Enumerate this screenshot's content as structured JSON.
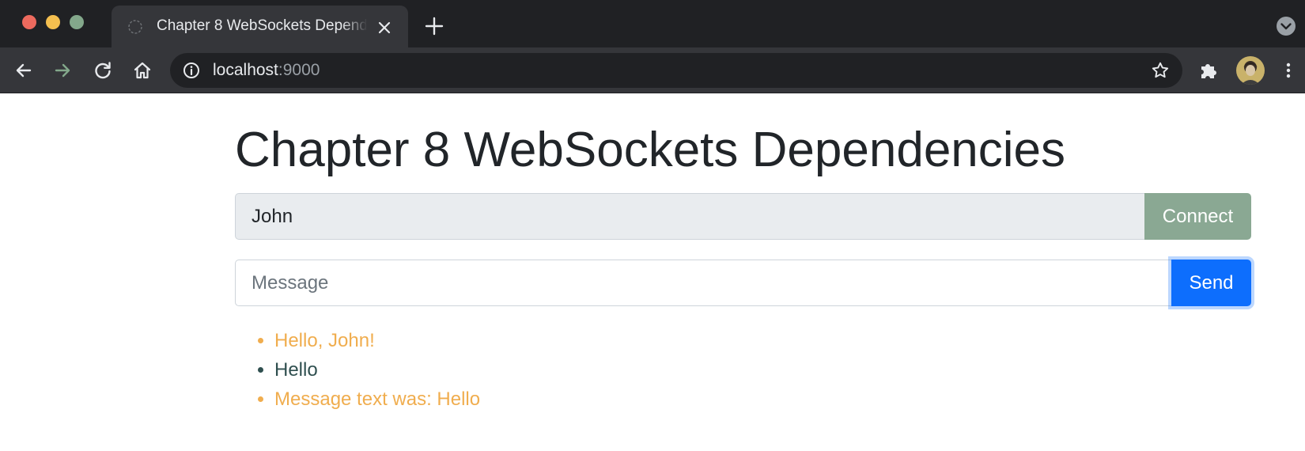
{
  "browser": {
    "tab_title": "Chapter 8 WebSockets Dependencies",
    "url_host": "localhost",
    "url_port": ":9000",
    "icons": [
      "back-icon",
      "forward-icon",
      "reload-icon",
      "home-icon",
      "info-icon",
      "star-icon",
      "extensions-icon",
      "new-tab-icon",
      "close-icon",
      "tab-search-icon"
    ],
    "colors": {
      "red": "#ed6a5e",
      "yellow": "#f4bf4f",
      "green": "#83a88b"
    }
  },
  "page": {
    "title": "Chapter 8 WebSockets Dependencies",
    "name_input": {
      "value": "John",
      "disabled": true
    },
    "connect_button": "Connect",
    "message_input": {
      "value": "",
      "placeholder": "Message"
    },
    "send_button": "Send",
    "messages": [
      {
        "text": "Hello, John!",
        "color": "#f0ad4e"
      },
      {
        "text": "Hello",
        "color": "#2f4f4f"
      },
      {
        "text": "Message text was: Hello",
        "color": "#f0ad4e"
      }
    ]
  }
}
